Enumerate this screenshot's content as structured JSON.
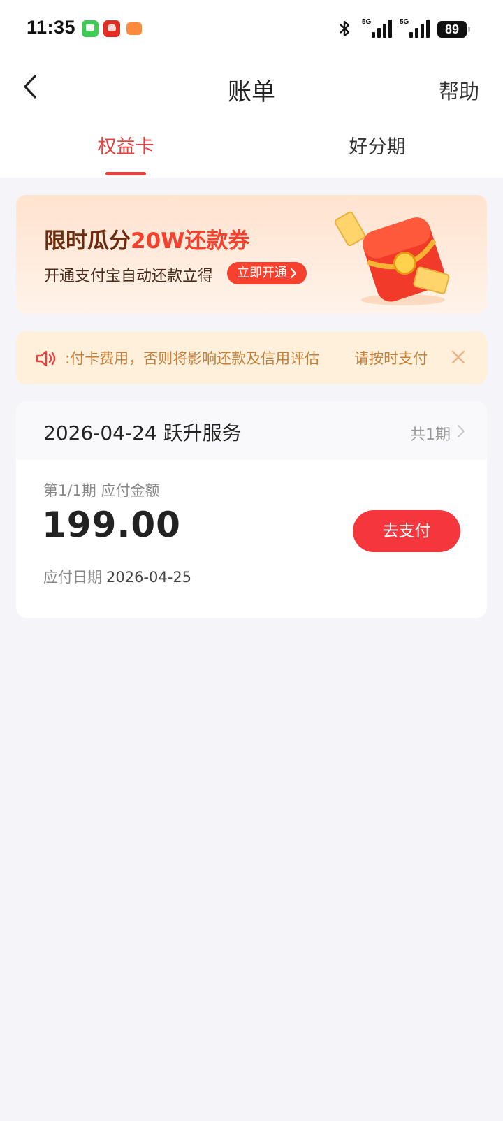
{
  "status_bar": {
    "time": "11:35",
    "network_1": "5G",
    "network_2": "5G",
    "battery": "89"
  },
  "nav": {
    "title": "账单",
    "help_label": "帮助"
  },
  "tabs": [
    {
      "label": "权益卡",
      "active": true
    },
    {
      "label": "好分期",
      "active": false
    }
  ],
  "promo": {
    "title_prefix": "限时瓜分",
    "title_highlight": "20W还款券",
    "subtitle": "开通支付宝自动还款立得",
    "button_label": "立即开通",
    "art_icon": "red-packet-icon"
  },
  "notice": {
    "icon": "speaker-icon",
    "text_part1": ":付卡费用，否则将影响还款及信用评估",
    "text_part2": "请按时支付"
  },
  "bill": {
    "header_title": "2026-04-24 跃升服务",
    "period_count": "共1期",
    "period_label": "第1/1期 应付金额",
    "amount": "199.00",
    "due_label": "应付日期",
    "due_date": "2026-04-25",
    "pay_button": "去支付"
  },
  "colors": {
    "accent": "#e64340",
    "pay_button": "#f5373d",
    "notice_text": "#c47f3b",
    "notice_bg": "#fff0dc",
    "page_bg": "#f4f4f9"
  }
}
